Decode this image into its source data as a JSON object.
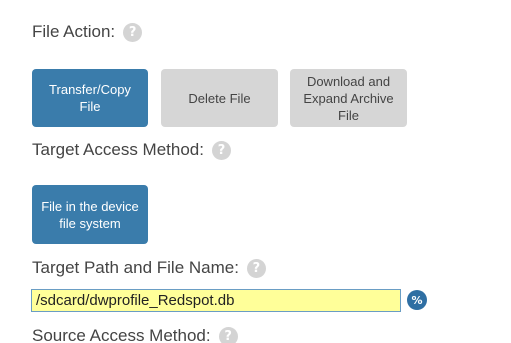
{
  "file_action": {
    "label": "File Action:",
    "help_icon": "?",
    "buttons": [
      {
        "label": "Transfer/Copy File",
        "state": "active"
      },
      {
        "label": "Delete File",
        "state": "inactive"
      },
      {
        "label": "Download and Expand Archive File",
        "state": "inactive"
      }
    ]
  },
  "target_access": {
    "label": "Target Access Method:",
    "help_icon": "?",
    "buttons": [
      {
        "label": "File in the device file system",
        "state": "active"
      }
    ]
  },
  "target_path": {
    "label": "Target Path and File Name:",
    "help_icon": "?",
    "value": "/sdcard/dwprofile_Redspot.db",
    "variable_icon": "%"
  },
  "source_access": {
    "label": "Source Access Method:",
    "help_icon": "?"
  },
  "colors": {
    "active_button": "#3a7cab",
    "inactive_button": "#d6d6d6",
    "input_highlight": "#ffff99"
  }
}
